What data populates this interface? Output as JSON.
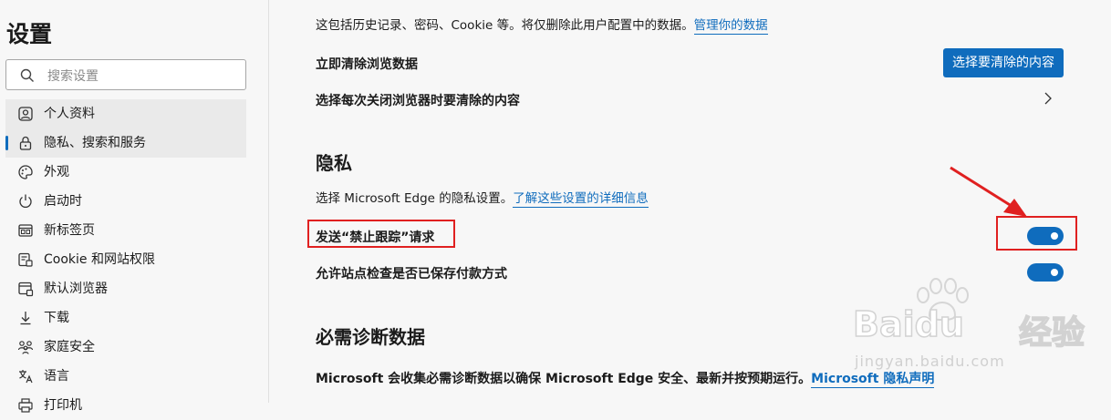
{
  "sidebar": {
    "title": "设置",
    "search_placeholder": "搜索设置",
    "items": [
      {
        "label": "个人资料"
      },
      {
        "label": "隐私、搜索和服务"
      },
      {
        "label": "外观"
      },
      {
        "label": "启动时"
      },
      {
        "label": "新标签页"
      },
      {
        "label": "Cookie 和网站权限"
      },
      {
        "label": "默认浏览器"
      },
      {
        "label": "下载"
      },
      {
        "label": "家庭安全"
      },
      {
        "label": "语言"
      },
      {
        "label": "打印机"
      }
    ]
  },
  "clear_data": {
    "description": "这包括历史记录、密码、Cookie 等。将仅删除此用户配置中的数据。",
    "manage_link": "管理你的数据",
    "clear_now_label": "立即清除浏览数据",
    "choose_button": "选择要清除的内容",
    "on_close_label": "选择每次关闭浏览器时要清除的内容"
  },
  "privacy": {
    "heading": "隐私",
    "description": "选择 Microsoft Edge 的隐私设置。",
    "learn_link": "了解这些设置的详细信息",
    "dnt_label": "发送“禁止跟踪”请求",
    "dnt_enabled": true,
    "payment_label": "允许站点检查是否已保存付款方式",
    "payment_enabled": true
  },
  "diagnostics": {
    "heading": "必需诊断数据",
    "description": "Microsoft 会收集必需诊断数据以确保 Microsoft Edge 安全、最新并按预期运行。",
    "statement_link": "Microsoft 隐私声明"
  },
  "watermark": {
    "brand": "Baidu",
    "brand_cn": "经验",
    "url": "jingyan.baidu.com"
  },
  "colors": {
    "accent": "#0f6cbd",
    "annotation_red": "#e02020"
  }
}
